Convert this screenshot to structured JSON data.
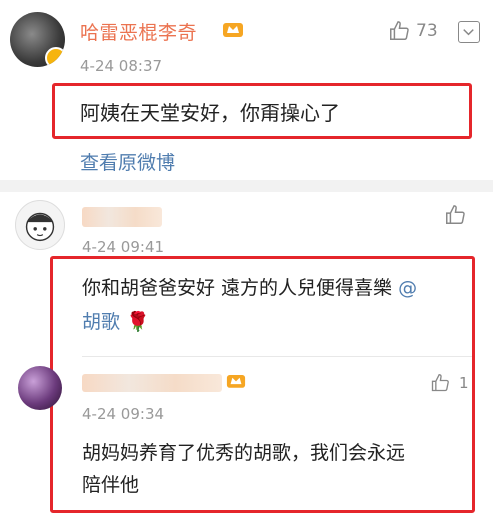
{
  "comment1": {
    "username": "哈雷恶棍李奇",
    "likes": "73",
    "time": "4-24 08:37",
    "text": "阿姨在天堂安好，你甭操心了",
    "view_original": "查看原微博"
  },
  "comment2": {
    "time": "4-24 09:41",
    "text_main": "你和胡爸爸安好 遠方的人兒便得喜樂 ",
    "mention": "@",
    "mention_name": "胡歌",
    "emoji": "🌹"
  },
  "reply": {
    "likes": "1",
    "time": "4-24 09:34",
    "text_line1": "胡妈妈养育了优秀的胡歌，我们会永远",
    "text_line2": "陪伴他"
  },
  "colors": {
    "username": "#eb7350",
    "link": "#507daf",
    "highlight_box": "#e5262b"
  }
}
